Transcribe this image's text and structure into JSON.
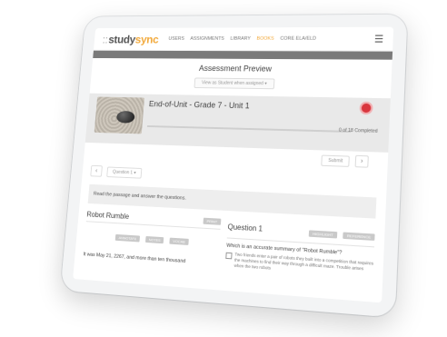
{
  "nav": {
    "logo_prefix": "::",
    "logo_study": "study",
    "logo_sync": "sync",
    "links": [
      "USERS",
      "ASSIGNMENTS",
      "LIBRARY",
      "BOOKS",
      "CORE ELA/ELD"
    ],
    "active_link": "BOOKS",
    "menu_icon": "hamburger-icon"
  },
  "preview": {
    "title": "Assessment Preview",
    "view_as": "View as Student when assigned"
  },
  "unit": {
    "title": "End-of-Unit - Grade 7 - Unit 1",
    "completed_text": "0 of 18 Completed",
    "progress": 0,
    "badge_color": "#d9363e"
  },
  "controls": {
    "submit_label": "Submit",
    "next_icon": "chevron-right-icon",
    "prev_icon": "chevron-left-icon",
    "question_select": "Question 1"
  },
  "instructions": "Read the passage and answer the questions.",
  "passage": {
    "title": "Robot Rumble",
    "top_button": "PRINT",
    "sub_buttons": [
      "ANNOTATE",
      "NOTES",
      "VOCAB"
    ],
    "first_line": "It was May 21, 2267, and more than ten thousand"
  },
  "question": {
    "title": "Question 1",
    "top_buttons": [
      "HIGHLIGHT",
      "REFERENCE"
    ],
    "prompt": "Which is an accurate summary of \"Robot Rumble\"?",
    "option_a": "Two friends enter a pair of robots they built into a competition that requires the machines to find their way through a difficult maze. Trouble arises when the two robots"
  }
}
